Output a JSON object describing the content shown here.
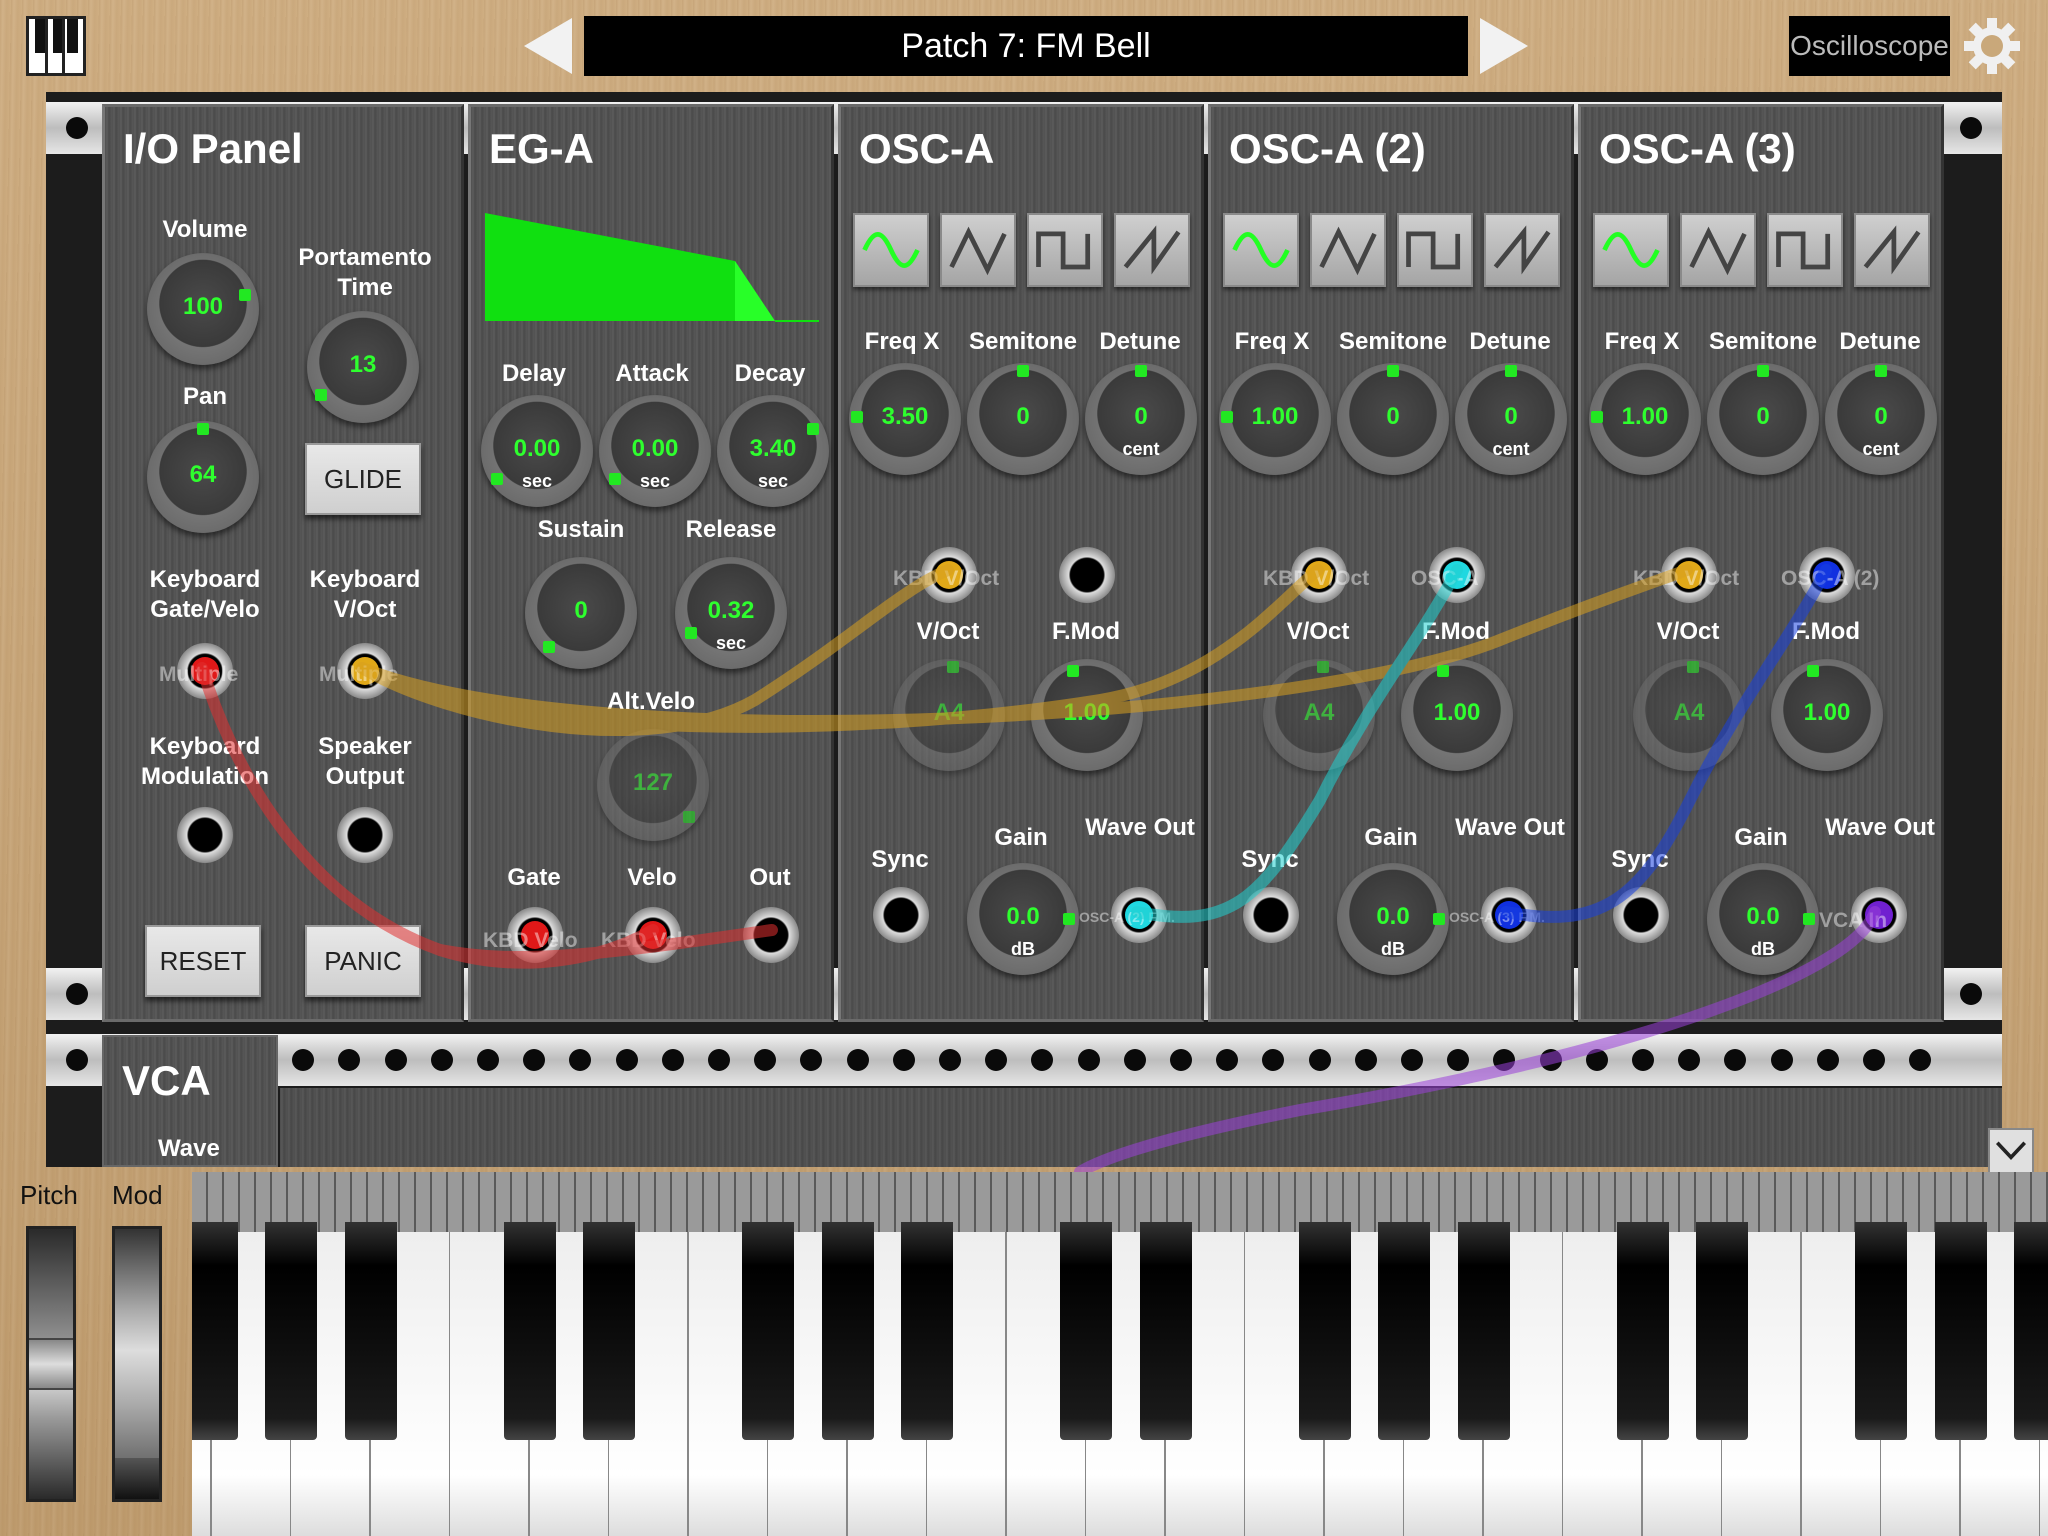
{
  "header": {
    "patch_name": "Patch 7: FM Bell",
    "oscilloscope_label": "Oscilloscope"
  },
  "io_panel": {
    "title": "I/O Panel",
    "volume": {
      "label": "Volume",
      "value": "100"
    },
    "portamento": {
      "label": "Portamento Time",
      "value": "13"
    },
    "pan": {
      "label": "Pan",
      "value": "64"
    },
    "glide_label": "GLIDE",
    "kbd_gate_velo": {
      "label": "Keyboard Gate/Velo",
      "jack_text": "Multiple"
    },
    "kbd_voct": {
      "label": "Keyboard V/Oct",
      "jack_text": "Multiple"
    },
    "kbd_mod_label": "Keyboard Modulation",
    "speaker_label": "Speaker Output",
    "reset_label": "RESET",
    "panic_label": "PANIC"
  },
  "eg_a": {
    "title": "EG-A",
    "delay": {
      "label": "Delay",
      "value": "0.00",
      "unit": "sec"
    },
    "attack": {
      "label": "Attack",
      "value": "0.00",
      "unit": "sec"
    },
    "decay": {
      "label": "Decay",
      "value": "3.40",
      "unit": "sec"
    },
    "sustain": {
      "label": "Sustain",
      "value": "0"
    },
    "release": {
      "label": "Release",
      "value": "0.32",
      "unit": "sec"
    },
    "alt_velo": {
      "label": "Alt.Velo",
      "value": "127"
    },
    "gate": {
      "label": "Gate",
      "jack_text": "KBD Velo"
    },
    "velo": {
      "label": "Velo",
      "jack_text": "KBD Velo"
    },
    "out_label": "Out"
  },
  "osc_modules": [
    {
      "title": "OSC-A",
      "freqx": {
        "label": "Freq X",
        "value": "3.50"
      },
      "semitone": {
        "label": "Semitone",
        "value": "0"
      },
      "detune": {
        "label": "Detune",
        "value": "0",
        "unit": "cent"
      },
      "voct_jack_text": "KBD V/Oct",
      "fmod_jack_text": "",
      "voct": {
        "label": "V/Oct",
        "value": "A4"
      },
      "fmod": {
        "label": "F.Mod",
        "value": "1.00"
      },
      "sync_label": "Sync",
      "gain": {
        "label": "Gain",
        "value": "0.0",
        "unit": "dB"
      },
      "wave_out_label": "Wave Out",
      "wave_out_jack_text": "OSC-A (2) F.M."
    },
    {
      "title": "OSC-A (2)",
      "freqx": {
        "label": "Freq X",
        "value": "1.00"
      },
      "semitone": {
        "label": "Semitone",
        "value": "0"
      },
      "detune": {
        "label": "Detune",
        "value": "0",
        "unit": "cent"
      },
      "voct_jack_text": "KBD V/Oct",
      "fmod_jack_text": "OSC-A",
      "voct": {
        "label": "V/Oct",
        "value": "A4"
      },
      "fmod": {
        "label": "F.Mod",
        "value": "1.00"
      },
      "sync_label": "Sync",
      "gain": {
        "label": "Gain",
        "value": "0.0",
        "unit": "dB"
      },
      "wave_out_label": "Wave Out",
      "wave_out_jack_text": "OSC-A (3) F.M."
    },
    {
      "title": "OSC-A (3)",
      "freqx": {
        "label": "Freq X",
        "value": "1.00"
      },
      "semitone": {
        "label": "Semitone",
        "value": "0"
      },
      "detune": {
        "label": "Detune",
        "value": "0",
        "unit": "cent"
      },
      "voct_jack_text": "KBD V/Oct",
      "fmod_jack_text": "OSC-A (2)",
      "voct": {
        "label": "V/Oct",
        "value": "A4"
      },
      "fmod": {
        "label": "F.Mod",
        "value": "1.00"
      },
      "sync_label": "Sync",
      "gain": {
        "label": "Gain",
        "value": "0.0",
        "unit": "dB"
      },
      "wave_out_label": "Wave Out",
      "wave_out_jack_text": "VCA In"
    }
  ],
  "vca": {
    "title": "VCA",
    "wave_label": "Wave"
  },
  "wheels": {
    "pitch_label": "Pitch",
    "mod_label": "Mod",
    "pitch_level": 0.5,
    "mod_level": 0.15
  },
  "colors": {
    "value_green": "#2eff2e",
    "cable_red": "#e03030",
    "cable_orange": "#d8a020",
    "cable_cyan": "#20d0d0",
    "cable_blue": "#1840e0",
    "cable_purple": "#9a40d8"
  },
  "icons": {
    "keyboard": "keyboard-icon",
    "prev": "prev-arrow-icon",
    "next": "next-arrow-icon",
    "settings": "gear-icon",
    "collapse": "chevron-down-icon",
    "waves": [
      "sine-wave-icon",
      "triangle-wave-icon",
      "square-wave-icon",
      "sawtooth-wave-icon"
    ]
  }
}
